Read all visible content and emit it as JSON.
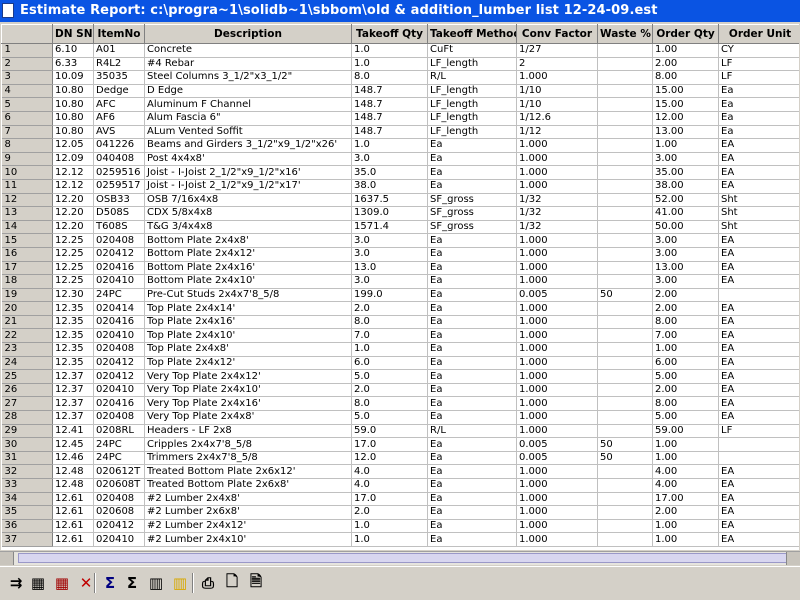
{
  "window": {
    "title": "Estimate Report: c:\\progra~1\\solidb~1\\sbbom\\old & addition_lumber list 12-24-09.est"
  },
  "table": {
    "columns": [
      "",
      "DN SN",
      "ItemNo",
      "Description",
      "Takeoff Qty",
      "Takeoff Method",
      "Conv Factor",
      "Waste %",
      "Order Qty",
      "Order Unit"
    ],
    "rows": [
      [
        "1",
        "6.10",
        "A01",
        "Concrete",
        "1.0",
        "CuFt",
        "1/27",
        "",
        "1.00",
        "CY"
      ],
      [
        "2",
        "6.33",
        "R4L2",
        "#4 Rebar",
        "1.0",
        "LF_length",
        "2",
        "",
        "2.00",
        "LF"
      ],
      [
        "3",
        "10.09",
        "35035",
        "Steel Columns 3_1/2\"x3_1/2\"",
        "8.0",
        "R/L",
        "1.000",
        "",
        "8.00",
        "LF"
      ],
      [
        "4",
        "10.80",
        "Dedge",
        "D Edge",
        "148.7",
        "LF_length",
        "1/10",
        "",
        "15.00",
        "Ea"
      ],
      [
        "5",
        "10.80",
        "AFC",
        "Aluminum F Channel",
        "148.7",
        "LF_length",
        "1/10",
        "",
        "15.00",
        "Ea"
      ],
      [
        "6",
        "10.80",
        "AF6",
        "Alum Fascia 6\"",
        "148.7",
        "LF_length",
        "1/12.6",
        "",
        "12.00",
        "Ea"
      ],
      [
        "7",
        "10.80",
        "AVS",
        "ALum Vented Soffit",
        "148.7",
        "LF_length",
        "1/12",
        "",
        "13.00",
        "Ea"
      ],
      [
        "8",
        "12.05",
        "041226",
        "Beams and Girders 3_1/2\"x9_1/2\"x26'",
        "1.0",
        "Ea",
        "1.000",
        "",
        "1.00",
        "EA"
      ],
      [
        "9",
        "12.09",
        "040408",
        "Post 4x4x8'",
        "3.0",
        "Ea",
        "1.000",
        "",
        "3.00",
        "EA"
      ],
      [
        "10",
        "12.12",
        "0259516",
        "Joist - I-Joist 2_1/2\"x9_1/2\"x16'",
        "35.0",
        "Ea",
        "1.000",
        "",
        "35.00",
        "EA"
      ],
      [
        "11",
        "12.12",
        "0259517",
        "Joist - I-Joist 2_1/2\"x9_1/2\"x17'",
        "38.0",
        "Ea",
        "1.000",
        "",
        "38.00",
        "EA"
      ],
      [
        "12",
        "12.20",
        "OSB33",
        "OSB 7/16x4x8",
        "1637.5",
        "SF_gross",
        "1/32",
        "",
        "52.00",
        "Sht"
      ],
      [
        "13",
        "12.20",
        "D508S",
        "CDX 5/8x4x8",
        "1309.0",
        "SF_gross",
        "1/32",
        "",
        "41.00",
        "Sht"
      ],
      [
        "14",
        "12.20",
        "T608S",
        "T&G 3/4x4x8",
        "1571.4",
        "SF_gross",
        "1/32",
        "",
        "50.00",
        "Sht"
      ],
      [
        "15",
        "12.25",
        "020408",
        "Bottom Plate 2x4x8'",
        "3.0",
        "Ea",
        "1.000",
        "",
        "3.00",
        "EA"
      ],
      [
        "16",
        "12.25",
        "020412",
        "Bottom Plate 2x4x12'",
        "3.0",
        "Ea",
        "1.000",
        "",
        "3.00",
        "EA"
      ],
      [
        "17",
        "12.25",
        "020416",
        "Bottom Plate 2x4x16'",
        "13.0",
        "Ea",
        "1.000",
        "",
        "13.00",
        "EA"
      ],
      [
        "18",
        "12.25",
        "020410",
        "Bottom Plate 2x4x10'",
        "3.0",
        "Ea",
        "1.000",
        "",
        "3.00",
        "EA"
      ],
      [
        "19",
        "12.30",
        "24PC",
        "Pre-Cut Studs 2x4x7'8_5/8",
        "199.0",
        "Ea",
        "0.005",
        "50",
        "2.00",
        ""
      ],
      [
        "20",
        "12.35",
        "020414",
        "Top Plate 2x4x14'",
        "2.0",
        "Ea",
        "1.000",
        "",
        "2.00",
        "EA"
      ],
      [
        "21",
        "12.35",
        "020416",
        "Top Plate 2x4x16'",
        "8.0",
        "Ea",
        "1.000",
        "",
        "8.00",
        "EA"
      ],
      [
        "22",
        "12.35",
        "020410",
        "Top Plate 2x4x10'",
        "7.0",
        "Ea",
        "1.000",
        "",
        "7.00",
        "EA"
      ],
      [
        "23",
        "12.35",
        "020408",
        "Top Plate 2x4x8'",
        "1.0",
        "Ea",
        "1.000",
        "",
        "1.00",
        "EA"
      ],
      [
        "24",
        "12.35",
        "020412",
        "Top Plate 2x4x12'",
        "6.0",
        "Ea",
        "1.000",
        "",
        "6.00",
        "EA"
      ],
      [
        "25",
        "12.37",
        "020412",
        "Very Top Plate 2x4x12'",
        "5.0",
        "Ea",
        "1.000",
        "",
        "5.00",
        "EA"
      ],
      [
        "26",
        "12.37",
        "020410",
        "Very Top Plate 2x4x10'",
        "2.0",
        "Ea",
        "1.000",
        "",
        "2.00",
        "EA"
      ],
      [
        "27",
        "12.37",
        "020416",
        "Very Top Plate 2x4x16'",
        "8.0",
        "Ea",
        "1.000",
        "",
        "8.00",
        "EA"
      ],
      [
        "28",
        "12.37",
        "020408",
        "Very Top Plate 2x4x8'",
        "5.0",
        "Ea",
        "1.000",
        "",
        "5.00",
        "EA"
      ],
      [
        "29",
        "12.41",
        "0208RL",
        "Headers - LF 2x8",
        "59.0",
        "R/L",
        "1.000",
        "",
        "59.00",
        "LF"
      ],
      [
        "30",
        "12.45",
        "24PC",
        "Cripples 2x4x7'8_5/8",
        "17.0",
        "Ea",
        "0.005",
        "50",
        "1.00",
        ""
      ],
      [
        "31",
        "12.46",
        "24PC",
        "Trimmers 2x4x7'8_5/8",
        "12.0",
        "Ea",
        "0.005",
        "50",
        "1.00",
        ""
      ],
      [
        "32",
        "12.48",
        "020612T",
        "Treated Bottom Plate 2x6x12'",
        "4.0",
        "Ea",
        "1.000",
        "",
        "4.00",
        "EA"
      ],
      [
        "33",
        "12.48",
        "020608T",
        "Treated Bottom Plate 2x6x8'",
        "4.0",
        "Ea",
        "1.000",
        "",
        "4.00",
        "EA"
      ],
      [
        "34",
        "12.61",
        "020408",
        "#2 Lumber 2x4x8'",
        "17.0",
        "Ea",
        "1.000",
        "",
        "17.00",
        "EA"
      ],
      [
        "35",
        "12.61",
        "020608",
        "#2 Lumber 2x6x8'",
        "2.0",
        "Ea",
        "1.000",
        "",
        "2.00",
        "EA"
      ],
      [
        "36",
        "12.61",
        "020412",
        "#2 Lumber 2x4x12'",
        "1.0",
        "Ea",
        "1.000",
        "",
        "1.00",
        "EA"
      ],
      [
        "37",
        "12.61",
        "020410",
        "#2 Lumber 2x4x10'",
        "1.0",
        "Ea",
        "1.000",
        "",
        "1.00",
        "EA"
      ]
    ]
  },
  "toolbar": {
    "buttons": [
      {
        "name": "insert-row-icon",
        "glyph": "⇉"
      },
      {
        "name": "grid-icon",
        "glyph": "▦"
      },
      {
        "name": "delete-grid-icon",
        "glyph": "▦"
      },
      {
        "name": "delete-icon",
        "glyph": "✕"
      },
      {
        "name": "sigma-subtotal-icon",
        "glyph": "Σ"
      },
      {
        "name": "sigma-total-icon",
        "glyph": "Σ"
      },
      {
        "name": "columns-icon",
        "glyph": "▥"
      },
      {
        "name": "yellow-columns-icon",
        "glyph": "▥"
      },
      {
        "name": "printer-icon",
        "glyph": "⎙"
      },
      {
        "name": "new-document-icon",
        "glyph": "🗋"
      },
      {
        "name": "report-document-icon",
        "glyph": "🗎"
      }
    ]
  },
  "colors": {
    "titlebar": "#0a54e3",
    "grid_header": "#d4d0c8",
    "window_bg": "#d4d0c8"
  }
}
